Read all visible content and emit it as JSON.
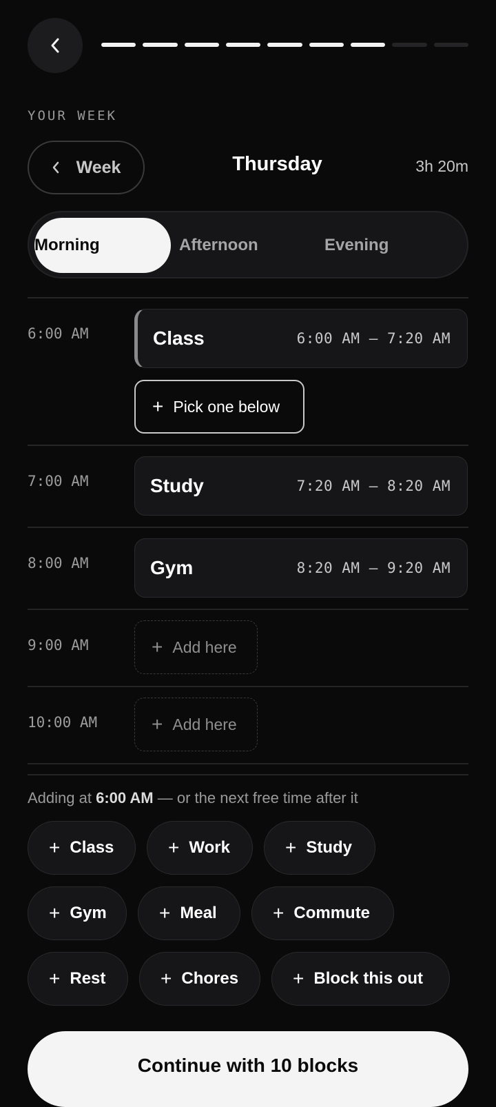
{
  "header": {
    "back_icon": "chevron-left-icon",
    "progress": {
      "completed": 7,
      "total": 9
    }
  },
  "section_label": "YOUR WEEK",
  "day_nav": {
    "week_label": "Week",
    "day_title": "Thursday",
    "total_time": "3h 20m"
  },
  "periods": [
    "Morning",
    "Afternoon",
    "Evening"
  ],
  "active_period": "Morning",
  "timeline": {
    "hours": [
      "6:00 AM",
      "7:00 AM",
      "8:00 AM",
      "9:00 AM",
      "10:00 AM"
    ],
    "blocks": [
      {
        "name": "Class",
        "range": "6:00 AM – 7:20 AM",
        "selected": true
      },
      {
        "name": "Study",
        "range": "7:20 AM – 8:20 AM",
        "selected": false
      },
      {
        "name": "Gym",
        "range": "8:20 AM – 9:20 AM",
        "selected": false
      }
    ],
    "pick_label": "Pick one below",
    "add_label": "Add here"
  },
  "hint": {
    "prefix": "Adding at ",
    "time": "6:00 AM",
    "suffix": " — or the next free time after it"
  },
  "chips": [
    "Class",
    "Work",
    "Study",
    "Gym",
    "Meal",
    "Commute",
    "Rest",
    "Chores",
    "Block this out"
  ],
  "cta_label": "Continue with 10 blocks",
  "colors": {
    "background": "#0a0a0a",
    "surface": "#161618",
    "accent": "#f4f4f4",
    "muted": "#9a9a9a"
  }
}
